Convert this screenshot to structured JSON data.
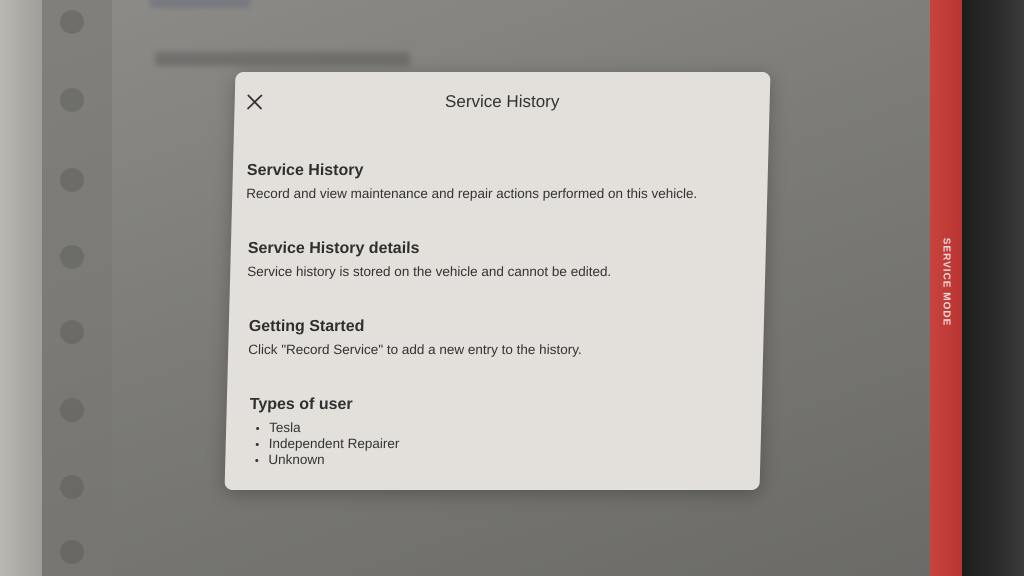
{
  "modal": {
    "title": "Service History",
    "close_icon": "close-icon",
    "sections": [
      {
        "heading": "Service History",
        "text": "Record and view maintenance and repair actions performed on this vehicle."
      },
      {
        "heading": "Service History details",
        "text": "Service history is stored on the vehicle and cannot be edited."
      },
      {
        "heading": "Getting Started",
        "text": "Click \"Record Service\" to add a new entry to the history."
      },
      {
        "heading": "Types of user",
        "items": [
          "Tesla",
          "Independent Repairer",
          "Unknown"
        ]
      }
    ]
  },
  "side_label": "SERVICE MODE",
  "colors": {
    "modal_bg": "#e3e0db",
    "service_mode_border": "#c9433e",
    "bezel": "#1d1d1d"
  }
}
